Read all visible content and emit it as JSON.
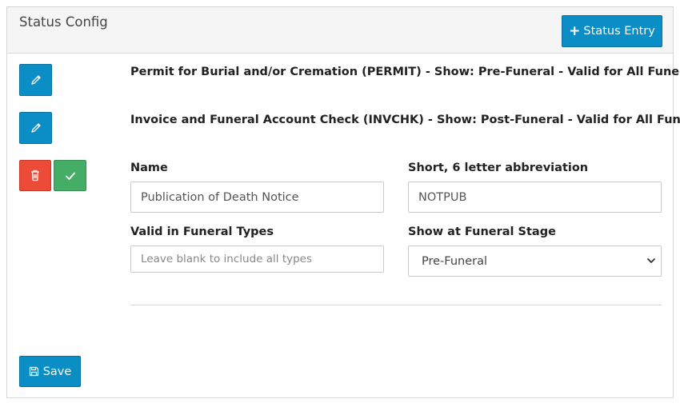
{
  "panel": {
    "title": "Status Config",
    "add_button_label": "Status Entry"
  },
  "statuses": [
    {
      "text": "Permit for Burial and/or Cremation (PERMIT) - Show: Pre-Funeral - Valid for All Funerals"
    },
    {
      "text": "Invoice and Funeral Account Check (INVCHK) - Show: Post-Funeral - Valid for All Funerals"
    }
  ],
  "form": {
    "name_label": "Name",
    "name_value": "Publication of Death Notice",
    "abbr_label": "Short, 6 letter abbreviation",
    "abbr_value": "NOTPUB",
    "types_label": "Valid in Funeral Types",
    "types_placeholder": "Leave blank to include all types",
    "stage_label": "Show at Funeral Stage",
    "stage_value": "Pre-Funeral"
  },
  "footer": {
    "save_label": "Save"
  },
  "colors": {
    "primary": "#0b8dc5",
    "danger": "#ec4b38",
    "success": "#44ad66"
  },
  "icons": [
    "plus-icon",
    "pencil-icon",
    "trash-icon",
    "check-icon",
    "chevron-down-icon",
    "floppy-disk-icon"
  ]
}
